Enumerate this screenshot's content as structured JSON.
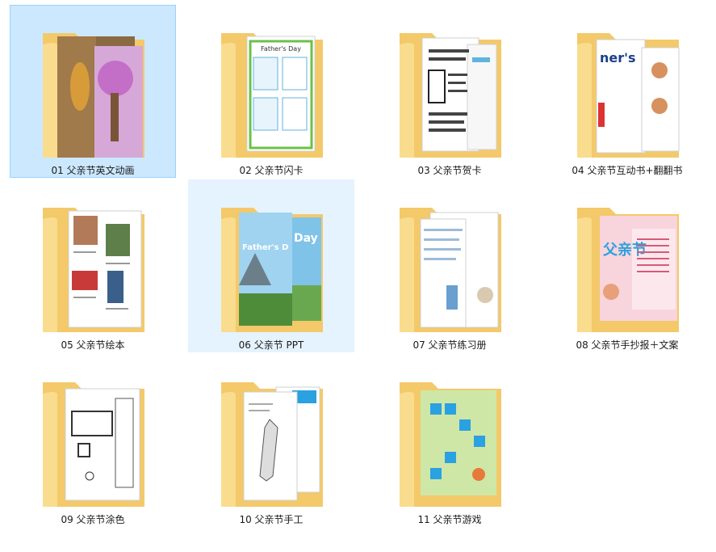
{
  "folders": [
    {
      "label": "01 父亲节英文动画",
      "icon": "folder-cartoon-preview-icon",
      "state": "selected"
    },
    {
      "label": "02 父亲节闪卡",
      "icon": "folder-flashcard-preview-icon",
      "state": "normal"
    },
    {
      "label": "03 父亲节贺卡",
      "icon": "folder-card-preview-icon",
      "state": "normal"
    },
    {
      "label": "04 父亲节互动书+翻翻书",
      "icon": "folder-book-preview-icon",
      "state": "normal"
    },
    {
      "label": "05 父亲节绘本",
      "icon": "folder-picturebook-preview-icon",
      "state": "normal"
    },
    {
      "label": "06 父亲节 PPT",
      "icon": "folder-ppt-preview-icon",
      "state": "hover"
    },
    {
      "label": "07 父亲节练习册",
      "icon": "folder-workbook-preview-icon",
      "state": "normal"
    },
    {
      "label": "08 父亲节手抄报＋文案",
      "icon": "folder-poster-preview-icon",
      "state": "normal"
    },
    {
      "label": "09 父亲节涂色",
      "icon": "folder-coloring-preview-icon",
      "state": "normal"
    },
    {
      "label": "10 父亲节手工",
      "icon": "folder-craft-preview-icon",
      "state": "normal"
    },
    {
      "label": "11 父亲节游戏",
      "icon": "folder-game-preview-icon",
      "state": "normal"
    }
  ],
  "preview_text": {
    "card2_heading": "Father's Day",
    "ppt_title_day": "Day",
    "ppt_title_main": "Father's D",
    "book_heading": "ner's",
    "poster_heading": "父亲节"
  }
}
